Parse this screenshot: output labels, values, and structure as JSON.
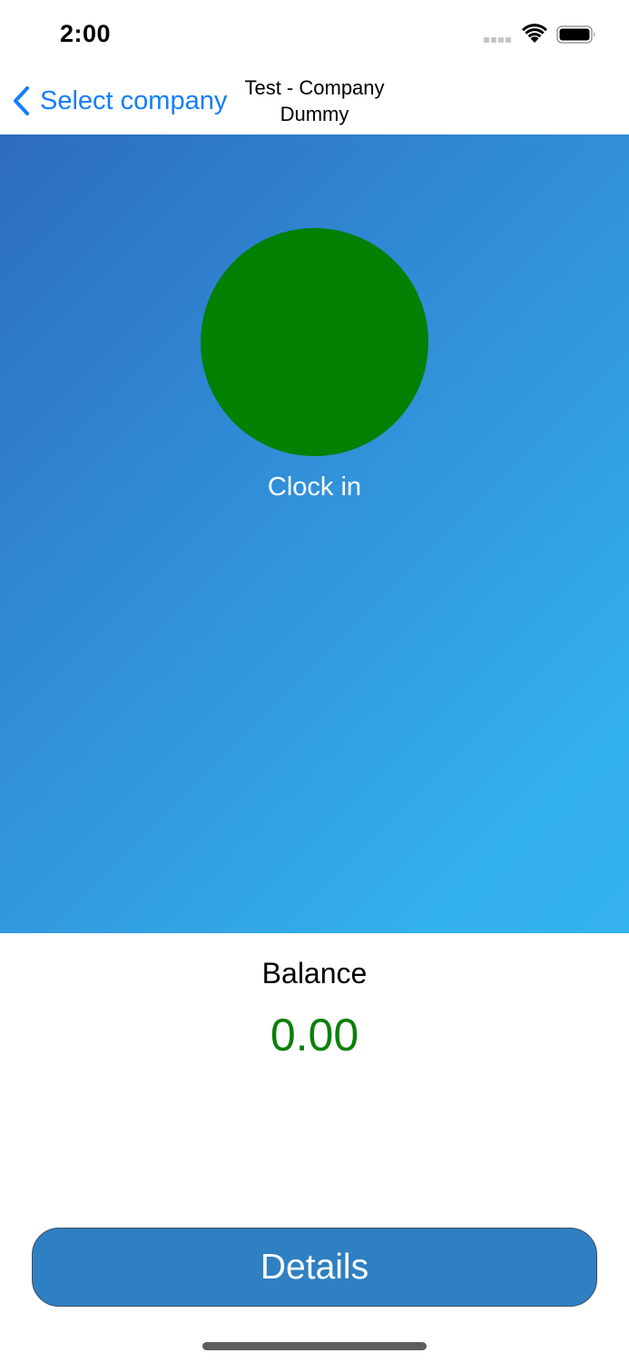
{
  "status_bar": {
    "time": "2:00",
    "icons": [
      "cellular-signal-icon",
      "wifi-icon",
      "battery-icon"
    ]
  },
  "nav": {
    "back_label": "Select company",
    "back_icon": "chevron-left-icon",
    "title": "Test - Company Dummy"
  },
  "hero": {
    "button_color": "#038103",
    "clock_label": "Clock in"
  },
  "balance": {
    "label": "Balance",
    "value": "0.00",
    "value_color": "#0a800a"
  },
  "footer": {
    "details_label": "Details"
  },
  "colors": {
    "accent": "#147efb",
    "hero_gradient_start": "#2d6cc0",
    "hero_gradient_end": "#35b3ef",
    "details_button": "#2f80c2"
  }
}
